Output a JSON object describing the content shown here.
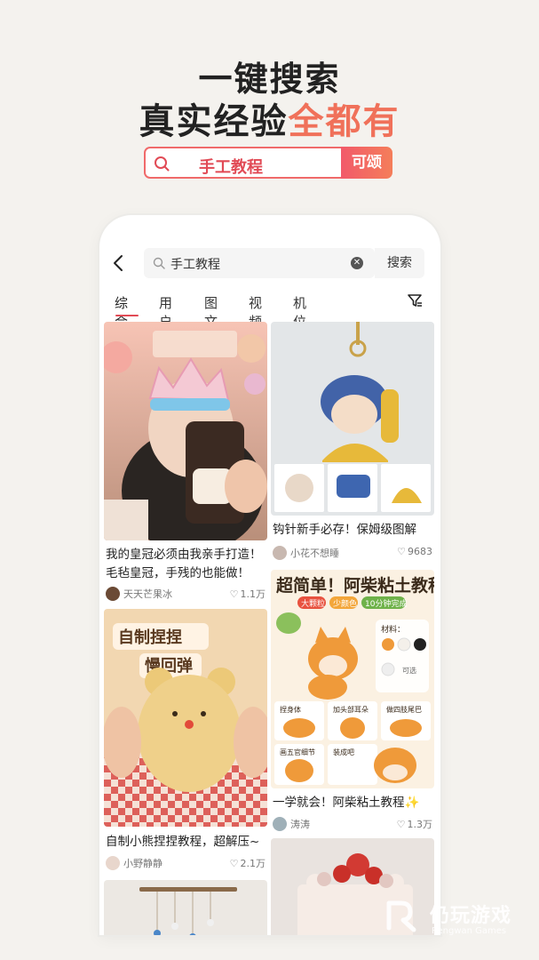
{
  "hero": {
    "line1": "一键搜索",
    "line2_main": "真实经验",
    "line2_accent": "全都有",
    "search_query": "手工教程",
    "search_button": "可颂"
  },
  "app": {
    "search_query": "手工教程",
    "search_action": "搜索",
    "tabs": [
      "综合",
      "用户",
      "图文",
      "视频",
      "机位"
    ],
    "active_tab": "综合"
  },
  "feed": {
    "left": [
      {
        "title": "我的皇冠必须由我亲手打造！毛毡皇冠，手残的也能做！",
        "author": "天天芒果冰",
        "likes": "1.1万",
        "image": "crown"
      },
      {
        "title": "自制小熊捏捏教程，超解压~",
        "author": "小野静静",
        "likes": "2.1万",
        "image_text_1": "自制捏捏",
        "image_text_2": "慢回弹",
        "image": "bear"
      },
      {
        "title": "",
        "author": "",
        "likes": "",
        "image": "wind-chime"
      }
    ],
    "right": [
      {
        "title": "钩针新手必存！保姆级图解",
        "author": "小花不想睡",
        "likes": "9683",
        "image": "crochet"
      },
      {
        "title": "一学就会！阿柴粘土教程✨",
        "author": "涛涛",
        "likes": "1.3万",
        "image": "shiba",
        "poster": {
          "headline": "超简单！阿柴粘土教程",
          "tags": [
            "大颗粒",
            "少颜色",
            "10分钟完成"
          ],
          "materials_label": "材料：",
          "materials": [
            "黄色",
            "白色",
            "黑色",
            "可选",
            "灰色"
          ],
          "steps": [
            "捏身体",
            "加头部耳朵",
            "做四肢尾巴",
            "画五官细节",
            "装成吧"
          ]
        }
      },
      {
        "title": "",
        "author": "",
        "likes": "",
        "image": "cake"
      }
    ]
  },
  "watermark": {
    "cn": "仍玩游戏",
    "en": "Rengwan Games"
  },
  "colors": {
    "accent": "#f0715a",
    "brand_red": "#e14a55",
    "background": "#f4f2ee"
  }
}
